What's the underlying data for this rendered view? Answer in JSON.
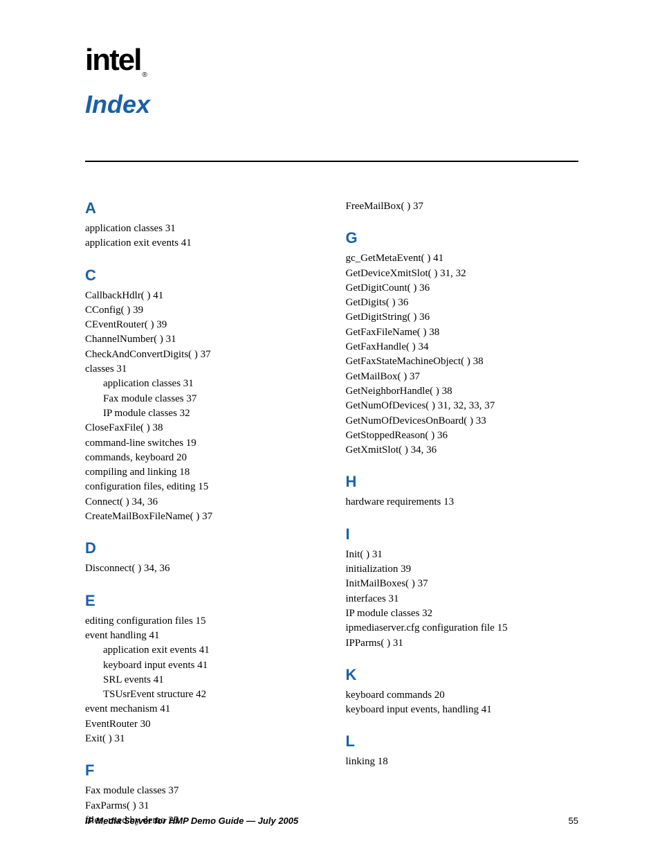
{
  "logo": {
    "text": "intel",
    "reg": "®"
  },
  "title": "Index",
  "footer": {
    "doc": "IP Media Server for HMP Demo Guide — July 2005",
    "page": "55"
  },
  "cols": [
    [
      {
        "letter": "A",
        "entries": [
          {
            "t": "application classes  31"
          },
          {
            "t": "application exit events  41"
          }
        ]
      },
      {
        "letter": "C",
        "entries": [
          {
            "t": "CallbackHdlr( )  41"
          },
          {
            "t": "CConfig( )  39"
          },
          {
            "t": "CEventRouter( )  39"
          },
          {
            "t": "ChannelNumber( )  31"
          },
          {
            "t": "CheckAndConvertDigits( )  37"
          },
          {
            "t": "classes  31"
          },
          {
            "t": "application classes   31",
            "sub": true
          },
          {
            "t": "Fax module classes   37",
            "sub": true
          },
          {
            "t": "IP module classes   32",
            "sub": true
          },
          {
            "t": "CloseFaxFile( )  38"
          },
          {
            "t": "command-line switches  19"
          },
          {
            "t": "commands, keyboard  20"
          },
          {
            "t": "compiling and linking  18"
          },
          {
            "t": "configuration files, editing  15"
          },
          {
            "t": "Connect( )  34, 36"
          },
          {
            "t": "CreateMailBoxFileName( )  37"
          }
        ]
      },
      {
        "letter": "D",
        "entries": [
          {
            "t": "Disconnect( )  34, 36"
          }
        ]
      },
      {
        "letter": "E",
        "entries": [
          {
            "t": "editing configuration files  15"
          },
          {
            "t": "event handling  41"
          },
          {
            "t": "application exit events  41",
            "sub": true
          },
          {
            "t": "keyboard input events  41",
            "sub": true
          },
          {
            "t": "SRL events  41",
            "sub": true
          },
          {
            "t": "TSUsrEvent structure  42",
            "sub": true
          },
          {
            "t": "event mechanism  41"
          },
          {
            "t": "EventRouter  30"
          },
          {
            "t": "Exit( )  31"
          }
        ]
      },
      {
        "letter": "F",
        "entries": [
          {
            "t": "Fax module classes  37"
          },
          {
            "t": "FaxParms( )  31"
          },
          {
            "t": "files, used by demo  25"
          }
        ]
      }
    ],
    [
      {
        "entries": [
          {
            "t": "FreeMailBox( )  37"
          }
        ]
      },
      {
        "letter": "G",
        "entries": [
          {
            "t": "gc_GetMetaEvent( )  41"
          },
          {
            "t": "GetDeviceXmitSlot( )  31, 32"
          },
          {
            "t": "GetDigitCount( )  36"
          },
          {
            "t": "GetDigits( )  36"
          },
          {
            "t": "GetDigitString( )  36"
          },
          {
            "t": "GetFaxFileName( )  38"
          },
          {
            "t": "GetFaxHandle( )  34"
          },
          {
            "t": "GetFaxStateMachineObject( )  38"
          },
          {
            "t": "GetMailBox( )  37"
          },
          {
            "t": "GetNeighborHandle( )  38"
          },
          {
            "t": "GetNumOfDevices( )  31, 32, 33, 37"
          },
          {
            "t": "GetNumOfDevicesOnBoard( )  33"
          },
          {
            "t": "GetStoppedReason( )  36"
          },
          {
            "t": "GetXmitSlot( )  34, 36"
          }
        ]
      },
      {
        "letter": "H",
        "entries": [
          {
            "t": "hardware requirements  13"
          }
        ]
      },
      {
        "letter": "I",
        "entries": [
          {
            "t": "Init( )  31"
          },
          {
            "t": "initialization  39"
          },
          {
            "t": "InitMailBoxes( )  37"
          },
          {
            "t": "interfaces  31"
          },
          {
            "t": "IP module classes  32"
          },
          {
            "t": "ipmediaserver.cfg configuration file  15"
          },
          {
            "t": "IPParms( )  31"
          }
        ]
      },
      {
        "letter": "K",
        "entries": [
          {
            "t": "keyboard commands  20"
          },
          {
            "t": "keyboard input events, handling  41"
          }
        ]
      },
      {
        "letter": "L",
        "entries": [
          {
            "t": "linking  18"
          }
        ]
      }
    ]
  ]
}
